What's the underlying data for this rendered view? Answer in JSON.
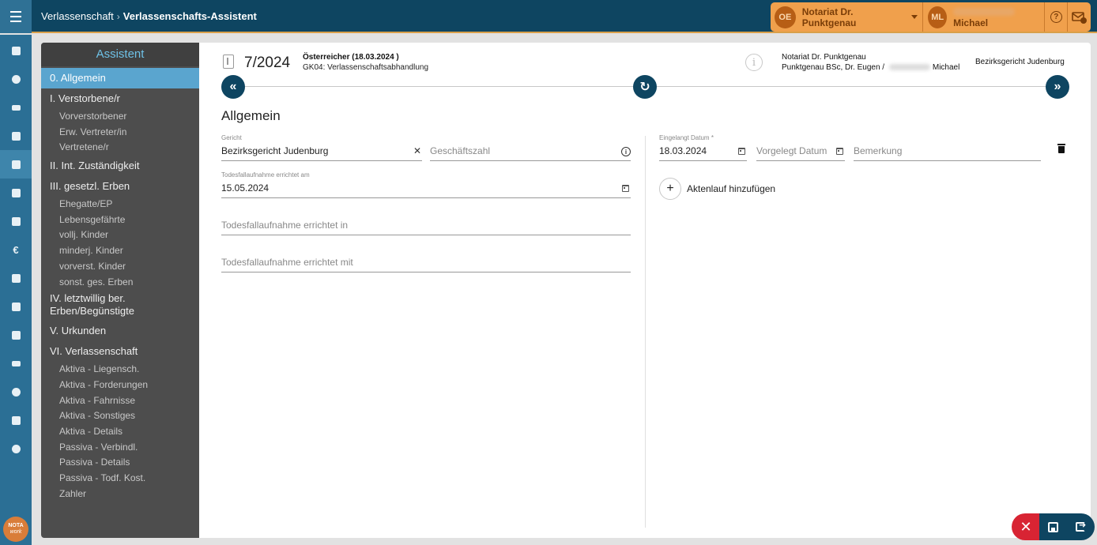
{
  "header": {
    "breadcrumb_root": "Verlassenschaft",
    "breadcrumb_current": "Verlassenschafts-Assistent",
    "office_initials": "OE",
    "office_name": "Notariat Dr. Punktgenau",
    "user_initials": "ML",
    "user_name": "Michael"
  },
  "rail": {
    "icons": [
      "calendar-check-icon",
      "user-icon",
      "list-icon",
      "library-icon",
      "notary-icon",
      "document-icon",
      "bank-icon",
      "euro-icon",
      "copy-icon",
      "square-icon",
      "file-icon",
      "ledger-icon",
      "info-icon",
      "chart-icon",
      "gear-icon"
    ],
    "logo_top": "NOTA",
    "logo_bottom": "work"
  },
  "sidebar": {
    "title": "Assistent",
    "items": [
      {
        "label": "0. Allgemein",
        "type": "main",
        "selected": true
      },
      {
        "label": "I. Verstorbene/r",
        "type": "main"
      },
      {
        "label": "Vorverstorbener",
        "type": "sub"
      },
      {
        "label": "Erw. Vertreter/in",
        "type": "sub"
      },
      {
        "label": "Vertretene/r",
        "type": "sub"
      },
      {
        "label": "II. Int. Zuständigkeit",
        "type": "main"
      },
      {
        "label": "III. gesetzl. Erben",
        "type": "main"
      },
      {
        "label": "Ehegatte/EP",
        "type": "sub"
      },
      {
        "label": "Lebensgefährte",
        "type": "sub"
      },
      {
        "label": "vollj. Kinder",
        "type": "sub"
      },
      {
        "label": "minderj. Kinder",
        "type": "sub"
      },
      {
        "label": "vorverst. Kinder",
        "type": "sub"
      },
      {
        "label": "sonst. ges. Erben",
        "type": "sub"
      },
      {
        "label": "IV. letztwillig ber. Erben/Begünstigte",
        "type": "main-two"
      },
      {
        "label": "V. Urkunden",
        "type": "main"
      },
      {
        "label": "VI. Verlassenschaft",
        "type": "main"
      },
      {
        "label": "Aktiva - Liegensch.",
        "type": "sub"
      },
      {
        "label": "Aktiva - Forderungen",
        "type": "sub"
      },
      {
        "label": "Aktiva - Fahrnisse",
        "type": "sub"
      },
      {
        "label": "Aktiva - Sonstiges",
        "type": "sub"
      },
      {
        "label": "Aktiva - Details",
        "type": "sub"
      },
      {
        "label": "Passiva - Verbindl.",
        "type": "sub"
      },
      {
        "label": "Passiva - Details",
        "type": "sub"
      },
      {
        "label": "Passiva - Todf. Kost.",
        "type": "sub"
      },
      {
        "label": "Zahler",
        "type": "sub"
      }
    ]
  },
  "case": {
    "number": "7/2024",
    "title": "Österreicher (18.03.2024 )",
    "subtitle": "GK04: Verlassenschaftsabhandlung",
    "notary_line1": "Notariat Dr. Punktgenau",
    "notary_line2_prefix": "Punktgenau BSc, Dr. Eugen / ",
    "notary_line2_suffix": "Michael",
    "court": "Bezirksgericht Judenburg"
  },
  "nav": {
    "prev": "«",
    "reload": "↻",
    "next": "»"
  },
  "form": {
    "section_title": "Allgemein",
    "gericht_label": "Gericht",
    "gericht_value": "Bezirksgericht Judenburg",
    "clear_glyph": "✕",
    "geschaeftszahl_placeholder": "Geschäftszahl",
    "todesfall_datum_label": "Todesfallaufnahme errichtet am",
    "todesfall_datum_value": "15.05.2024",
    "todesfall_in_placeholder": "Todesfallaufnahme errichtet in",
    "todesfall_mit_placeholder": "Todesfallaufnahme errichtet mit",
    "eingelangt_label": "Eingelangt Datum *",
    "eingelangt_value": "18.03.2024",
    "vorgelegt_placeholder": "Vorgelegt Datum",
    "bemerkung_placeholder": "Bemerkung",
    "add_aktenlauf_label": "Aktenlauf hinzufügen",
    "add_glyph": "+"
  },
  "actions": {
    "cancel_glyph": "✕"
  }
}
